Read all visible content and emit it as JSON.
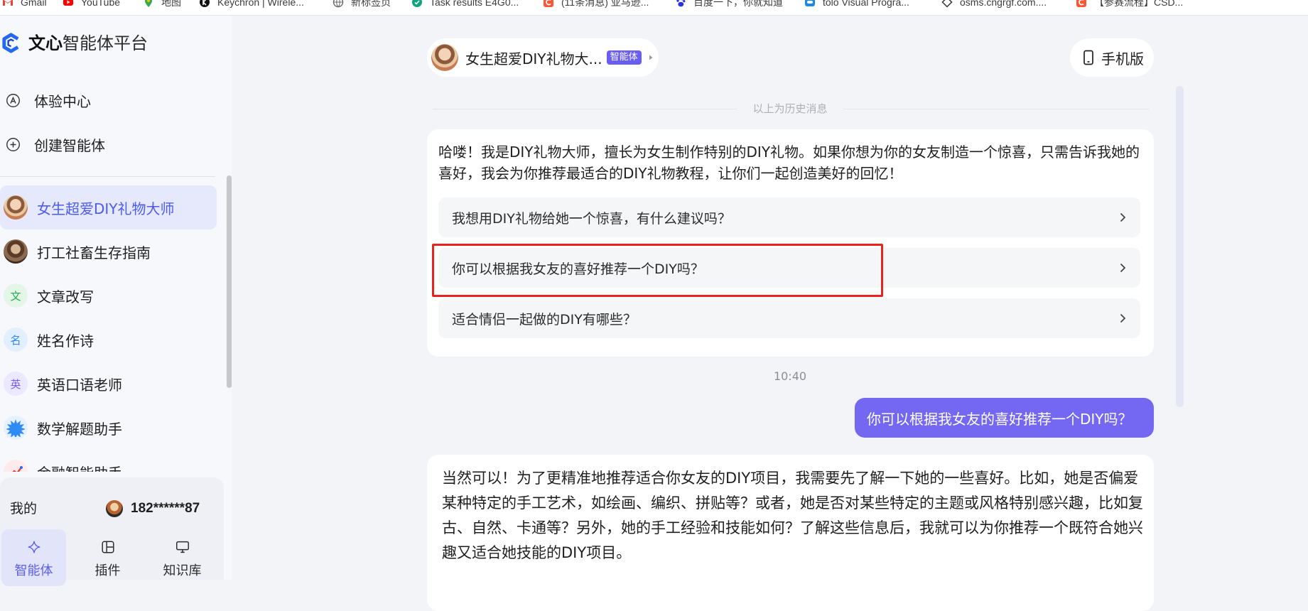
{
  "browser": {
    "bookmarks": [
      {
        "label": "Gmail",
        "icon": "gmail-icon"
      },
      {
        "label": "YouTube",
        "icon": "youtube-icon"
      },
      {
        "label": "地图",
        "icon": "maps-icon"
      },
      {
        "label": "Keychron | Wirele...",
        "icon": "keychron-icon"
      },
      {
        "label": "新标签页",
        "icon": "globe-icon"
      },
      {
        "label": "Task results E4G0...",
        "icon": "task-icon"
      },
      {
        "label": "(11条消息) 亚马逊...",
        "icon": "csdn-icon"
      },
      {
        "label": "百度一下，你就知道",
        "icon": "baidu-icon"
      },
      {
        "label": "tolo Visual Progra...",
        "icon": "tolo-icon"
      },
      {
        "label": "osms.cngrgf.com....",
        "icon": "diamond-icon"
      },
      {
        "label": "【参赛流程】CSD...",
        "icon": "csdn-icon"
      }
    ]
  },
  "sidebar": {
    "logo": {
      "brand": "文心",
      "product": "智能体平台",
      "icon": "wenxin-logo-icon"
    },
    "menu": [
      {
        "label": "体验中心",
        "icon": "a-circle-icon"
      },
      {
        "label": "创建智能体",
        "icon": "plus-circle-icon"
      }
    ],
    "agents": [
      {
        "label": "女生超爱DIY礼物大师",
        "avatar": "photo",
        "selected": true
      },
      {
        "label": "打工社畜生存指南",
        "avatar": "photo",
        "selected": false
      },
      {
        "label": "文章改写",
        "avatar_text": "文",
        "selected": false
      },
      {
        "label": "姓名作诗",
        "avatar_text": "名",
        "selected": false
      },
      {
        "label": "英语口语老师",
        "avatar_text": "英",
        "selected": false
      },
      {
        "label": "数学解题助手",
        "icon": "starburst-icon",
        "selected": false
      },
      {
        "label": "金融智能助手",
        "icon": "finance-icon",
        "selected": false
      }
    ],
    "account": {
      "label": "我的",
      "phone": "182******87"
    },
    "tabs": [
      {
        "label": "智能体",
        "icon": "sparkle-icon",
        "selected": true
      },
      {
        "label": "插件",
        "icon": "plugin-icon",
        "selected": false
      },
      {
        "label": "知识库",
        "icon": "knowledge-monitor-icon",
        "selected": false
      }
    ]
  },
  "chat": {
    "header": {
      "agent_name": "女生超爱DIY礼物大...",
      "badge": "智能体"
    },
    "mobile_button": {
      "label": "手机版",
      "icon": "phone-icon"
    },
    "history_divider": "以上为历史消息",
    "greeting": {
      "text": "哈喽！我是DIY礼物大师，擅长为女生制作特别的DIY礼物。如果你想为你的女友制造一个惊喜，只需告诉我她的喜好，我会为你推荐最适合的DIY礼物教程，让你们一起创造美好的回忆！",
      "suggestions": [
        "我想用DIY礼物给她一个惊喜，有什么建议吗？",
        "你可以根据我女友的喜好推荐一个DIY吗？",
        "适合情侣一起做的DIY有哪些？"
      ]
    },
    "timestamp": "10:40",
    "user_message": "你可以根据我女友的喜好推荐一个DIY吗？",
    "reply": "当然可以！为了更精准地推荐适合你女友的DIY项目，我需要先了解一下她的一些喜好。比如，她是否偏爱某种特定的手工艺术，如绘画、编织、拼贴等？或者，她是否对某些特定的主题或风格特别感兴趣，比如复古、自然、卡通等？另外，她的手工经验和技能如何？了解这些信息后，我就可以为你推荐一个既符合她兴趣又适合她技能的DIY项目。"
  },
  "colors": {
    "accent": "#5b5ef0",
    "user_bubble": "#7468f2",
    "badge": "#6a5df2",
    "highlight_box": "#e8231e"
  }
}
